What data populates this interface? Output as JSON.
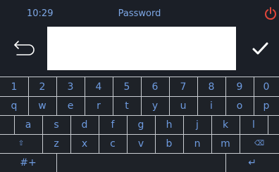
{
  "status_bar": {
    "time": "10:29",
    "title": "Password"
  },
  "password_field": {
    "value": "",
    "placeholder": ""
  },
  "icons": {
    "power": "power-icon",
    "back": "back-arrow-icon",
    "confirm": "checkmark-icon",
    "shift": "shift-icon",
    "backspace": "backspace-icon",
    "enter": "enter-icon"
  },
  "colors": {
    "background": "#1b1f27",
    "accent_text": "#7ea8e6",
    "power": "#e0463a",
    "key_text": "#6e9be0",
    "grid_lines": "#c9cdd2",
    "input_bg": "#ffffff"
  },
  "keyboard": {
    "rows": [
      [
        "1",
        "2",
        "3",
        "4",
        "5",
        "6",
        "7",
        "8",
        "9",
        "0"
      ],
      [
        "q",
        "w",
        "e",
        "r",
        "t",
        "y",
        "u",
        "i",
        "o",
        "p"
      ],
      [
        "a",
        "s",
        "d",
        "f",
        "g",
        "h",
        "j",
        "k",
        "l"
      ],
      [
        "⇧",
        "z",
        "x",
        "c",
        "v",
        "b",
        "n",
        "m",
        "⌫"
      ],
      [
        "#+",
        "",
        "↵"
      ]
    ]
  }
}
